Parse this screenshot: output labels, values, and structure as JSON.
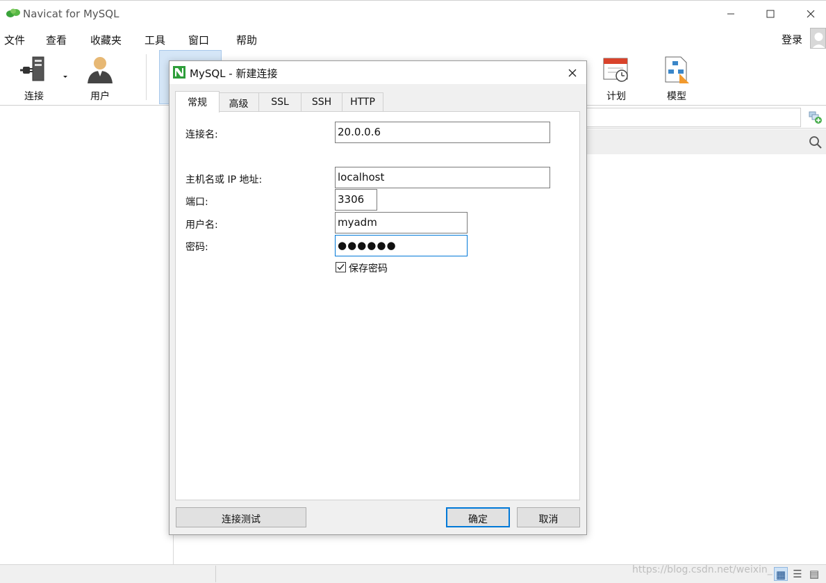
{
  "window": {
    "title": "Navicat for MySQL",
    "controls": [
      "minimize-icon",
      "maximize-icon",
      "close-icon"
    ]
  },
  "menubar": {
    "items": [
      "文件",
      "查看",
      "收藏夹",
      "工具",
      "窗口",
      "帮助"
    ],
    "login": "登录"
  },
  "toolbar": {
    "connect": "连接",
    "user": "用户",
    "schedule": "计划",
    "model": "模型"
  },
  "dialog": {
    "title": "MySQL - 新建连接",
    "tabs": [
      "常规",
      "高级",
      "SSL",
      "SSH",
      "HTTP"
    ],
    "active_tab": "常规",
    "fields": {
      "connection_name_label": "连接名:",
      "connection_name_value": "20.0.0.6",
      "host_label": "主机名或 IP 地址:",
      "host_value": "localhost",
      "port_label": "端口:",
      "port_value": "3306",
      "username_label": "用户名:",
      "username_value": "myadm",
      "password_label": "密码:",
      "password_value": "●●●●●●"
    },
    "save_password": {
      "label": "保存密码",
      "checked": true
    },
    "buttons": {
      "test": "连接测试",
      "ok": "确定",
      "cancel": "取消"
    }
  },
  "statusbar": {
    "watermark": "https://blog.csdn.net/weixin_"
  },
  "colors": {
    "accent": "#0078d7",
    "toolbar_highlight": "#d5e6f7",
    "navicat_green": "#2e9e3a"
  }
}
